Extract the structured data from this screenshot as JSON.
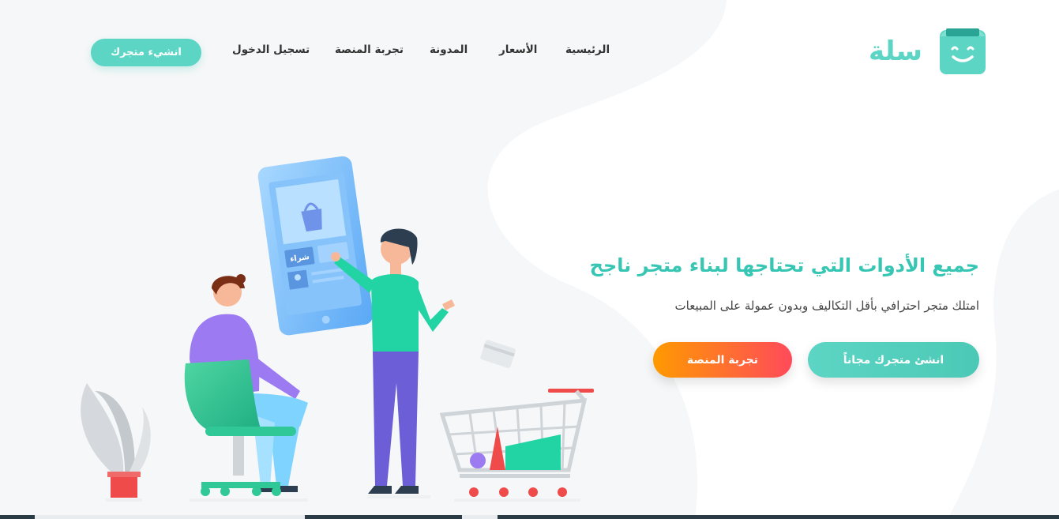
{
  "brand": {
    "name": "سلة",
    "logo_icon": "smiling-bag-icon",
    "accent": "#5dd5c4"
  },
  "nav": {
    "items": [
      {
        "label": "الرئيسية"
      },
      {
        "label": "الأسعار"
      },
      {
        "label": "المدونة"
      },
      {
        "label": "تجربة المنصة"
      },
      {
        "label": "تسجيل الدخول"
      }
    ],
    "cta_label": "انشيء متجرك"
  },
  "hero": {
    "title": "جميع الأدوات التي تحتاجها لبناء متجر ناجح",
    "subtitle": "امتلك متجر احترافي بأقل التكاليف وبدون عمولة على المبيعات",
    "primary_button": "انشئ متجرك مجاناً",
    "secondary_button": "تجربة المنصة",
    "colors": {
      "primary": "#5dd5c4",
      "secondary_from": "#ff9a00",
      "secondary_to": "#ff4a5a"
    }
  },
  "illustration": {
    "phone_button_label": "شراء"
  }
}
